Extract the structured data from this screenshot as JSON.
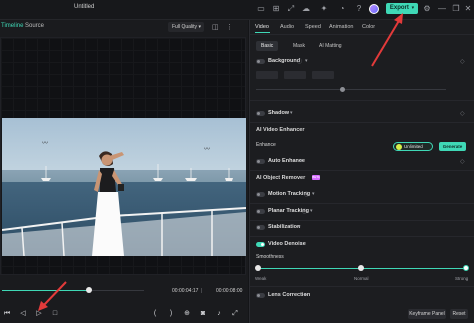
{
  "window": {
    "title": "Untitled",
    "export_label": "Export",
    "export_dropdown": "▾"
  },
  "player": {
    "tabs": [
      "Timeline",
      "Source"
    ],
    "quality_label": "Full Quality",
    "time_current": "00:00:04:17",
    "time_total": "00:00:08:00",
    "progress": 0.61
  },
  "inspector": {
    "tabs": [
      "Video",
      "Audio",
      "Speed",
      "Animation",
      "Color"
    ],
    "subtabs": [
      "Basic",
      "Mask",
      "AI Matting"
    ],
    "background": {
      "label": "Background"
    },
    "shadow": {
      "label": "Shadow"
    },
    "ai_video_enhancer": {
      "label": "AI Video Enhancer"
    },
    "enhance": {
      "label": "Enhance",
      "unlimited_label": "Unlimited",
      "generate_label": "Generate"
    },
    "auto_enhance": {
      "label": "Auto Enhance"
    },
    "ai_object_remover": {
      "label": "AI Object Remover",
      "badge": "BETA"
    },
    "motion_tracking": {
      "label": "Motion Tracking"
    },
    "planar_tracking": {
      "label": "Planar Tracking"
    },
    "stabilization": {
      "label": "Stabilization"
    },
    "video_denoise": {
      "label": "Video Denoise"
    },
    "smoothness": {
      "label": "Smoothness",
      "weak": "Weak",
      "normal": "Normal",
      "strong": "Strong",
      "value": "Strong"
    },
    "lens_correction": {
      "label": "Lens Correction"
    },
    "footer": {
      "keyframe_label": "Keyframe Panel",
      "reset_label": "Reset"
    }
  },
  "colors": {
    "accent": "#3fd8b6",
    "annotation_arrow": "#e23a3a"
  }
}
